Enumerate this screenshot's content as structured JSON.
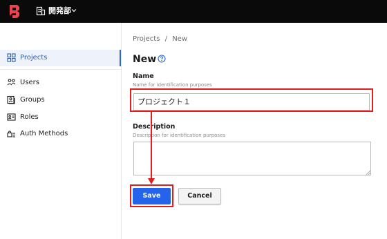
{
  "topbar": {
    "logo_icon": "boundary-logo-icon",
    "org_icon": "building-icon",
    "org_name": "開発部",
    "chevron_icon": "chevron-down-icon"
  },
  "sidebar": {
    "items": [
      {
        "label": "Projects",
        "icon": "grid-icon",
        "active": true
      },
      {
        "label": "Users",
        "icon": "users-icon",
        "active": false
      },
      {
        "label": "Groups",
        "icon": "groups-icon",
        "active": false
      },
      {
        "label": "Roles",
        "icon": "id-card-icon",
        "active": false
      },
      {
        "label": "Auth Methods",
        "icon": "auth-methods-icon",
        "active": false
      }
    ]
  },
  "main": {
    "breadcrumb": {
      "parent": "Projects",
      "separator": "/",
      "current": "New"
    },
    "title": "New",
    "help_icon": "help-circle-icon",
    "name_field": {
      "label": "Name",
      "help": "Name for identification purposes",
      "value": "プロジェクト１"
    },
    "description_field": {
      "label": "Description",
      "help": "Description for identification purposes",
      "value": ""
    },
    "save_label": "Save",
    "cancel_label": "Cancel"
  },
  "colors": {
    "topbar_bg": "#0a0a0a",
    "accent_blue": "#2563eb",
    "active_nav_text": "#2d5ca8",
    "annotation_red": "#e01e1e"
  }
}
